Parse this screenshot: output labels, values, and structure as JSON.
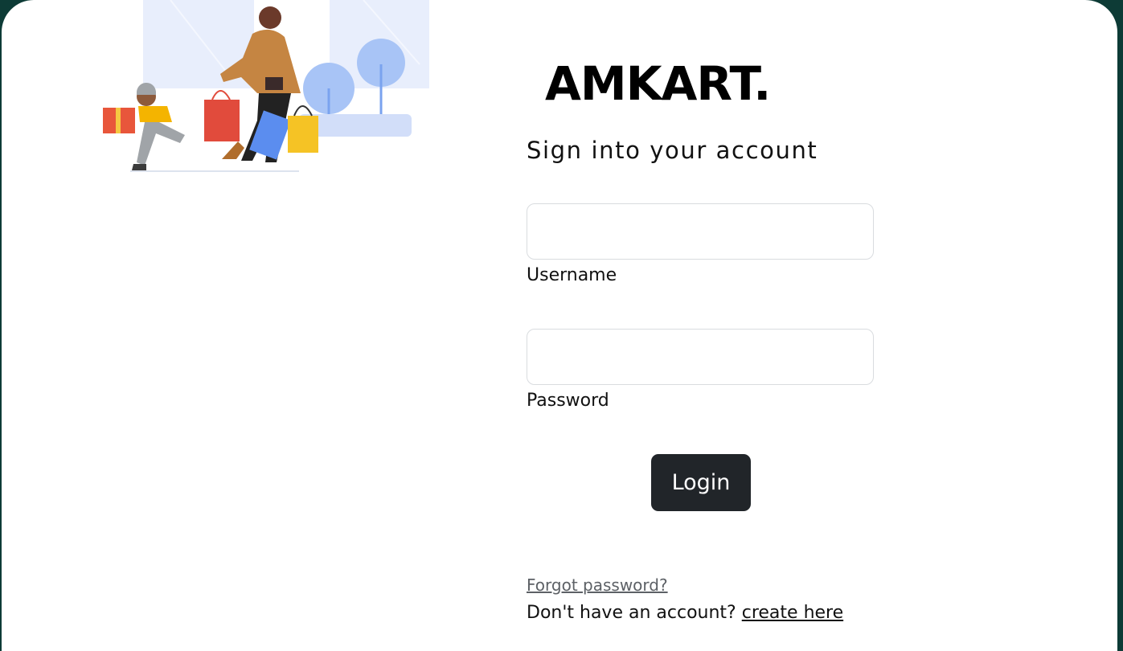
{
  "brand": {
    "name": "AMKART."
  },
  "login": {
    "subtitle": "Sign into your account",
    "username_label": "Username",
    "password_label": "Password",
    "username_value": "",
    "password_value": "",
    "login_button": "Login",
    "forgot_password": "Forgot password?",
    "no_account_text": "Don't have an account?",
    "create_link": "create here"
  },
  "colors": {
    "button_bg": "#212529",
    "page_frame": "#0d3b36",
    "card_bg": "#ffffff",
    "field_border": "#d9dcdf"
  },
  "illustration": {
    "icon": "shopping-people-illustration"
  }
}
